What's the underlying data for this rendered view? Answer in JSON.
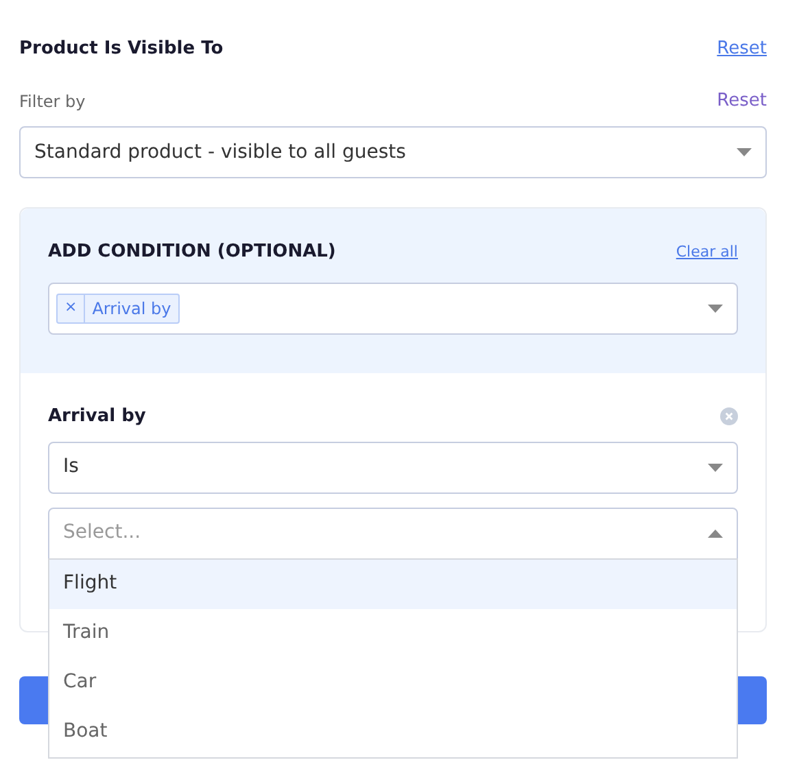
{
  "section": {
    "title": "Product Is Visible To",
    "reset_link": "Reset"
  },
  "filter": {
    "label": "Filter by",
    "reset_link": "Reset",
    "value": "Standard product - visible to all guests"
  },
  "condition_panel": {
    "heading": "ADD CONDITION (OPTIONAL)",
    "clear_link": "Clear all",
    "tags": [
      {
        "remove": "×",
        "label": "Arrival by"
      }
    ]
  },
  "condition": {
    "label": "Arrival by",
    "operator": "Is",
    "value_field": {
      "placeholder": "Select...",
      "expanded": true
    },
    "options": [
      {
        "label": "Flight",
        "selected": true
      },
      {
        "label": "Train",
        "selected": false
      },
      {
        "label": "Car",
        "selected": false
      },
      {
        "label": "Boat",
        "selected": false
      }
    ]
  }
}
